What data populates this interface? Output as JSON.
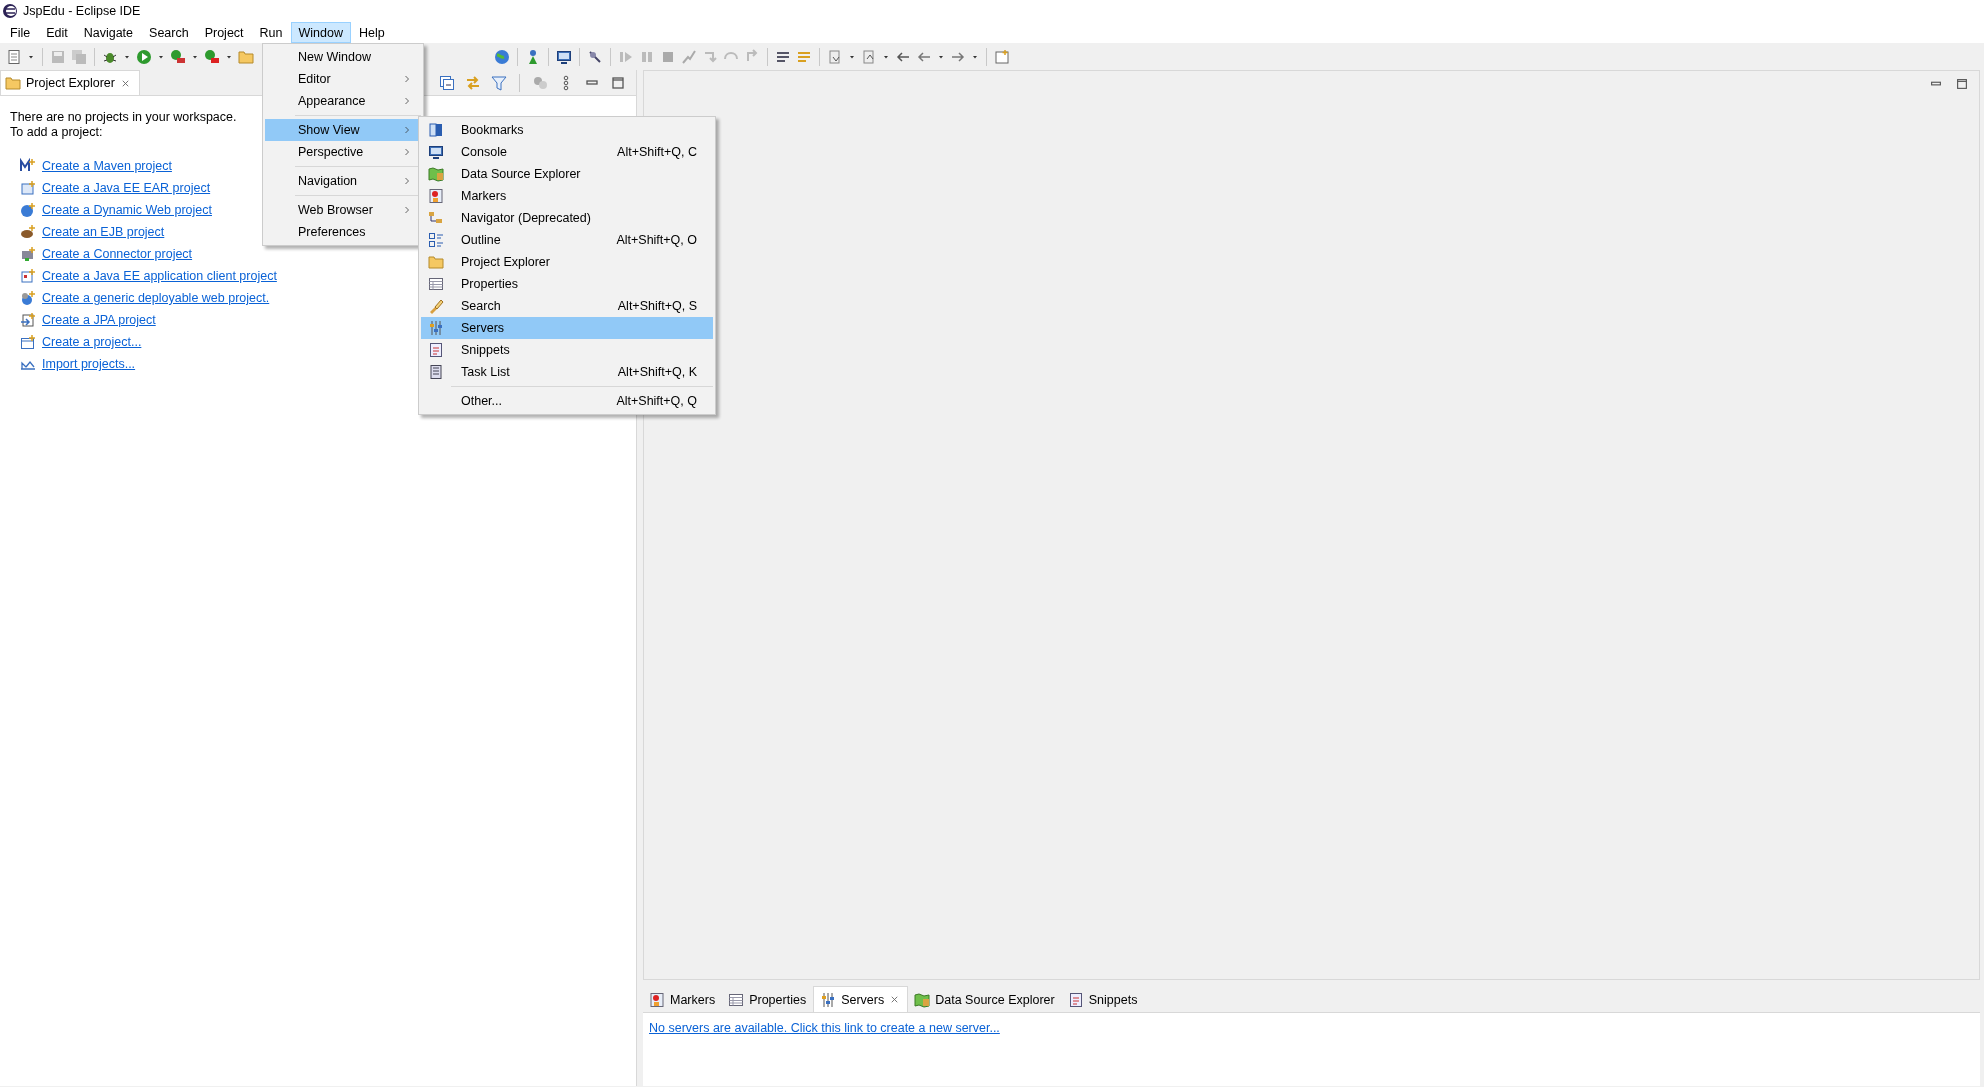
{
  "window": {
    "title": "JspEdu - Eclipse IDE"
  },
  "menu_bar": [
    {
      "label": "File",
      "selected": false
    },
    {
      "label": "Edit",
      "selected": false
    },
    {
      "label": "Navigate",
      "selected": false
    },
    {
      "label": "Search",
      "selected": false
    },
    {
      "label": "Project",
      "selected": false
    },
    {
      "label": "Run",
      "selected": false
    },
    {
      "label": "Window",
      "selected": true
    },
    {
      "label": "Help",
      "selected": false
    }
  ],
  "project_explorer": {
    "tab": {
      "label": "Project Explorer",
      "selected": true
    },
    "message": [
      "There are no projects in your workspace.",
      "To add a project:"
    ],
    "links": [
      "Create a Maven project",
      "Create a Java EE EAR project",
      "Create a Dynamic Web project",
      "Create an EJB project",
      "Create a Connector project",
      "Create a Java EE application client project",
      "Create a generic deployable web project.",
      "Create a JPA project",
      "Create a project...",
      "Import projects..."
    ]
  },
  "window_menu": [
    {
      "label": "New Window",
      "submenu": false,
      "selected": false,
      "separator_before": false
    },
    {
      "label": "Editor",
      "submenu": true,
      "selected": false,
      "separator_before": false
    },
    {
      "label": "Appearance",
      "submenu": true,
      "selected": false,
      "separator_before": false
    },
    {
      "label": "Show View",
      "submenu": true,
      "selected": true,
      "separator_before": true
    },
    {
      "label": "Perspective",
      "submenu": true,
      "selected": false,
      "separator_before": false
    },
    {
      "label": "Navigation",
      "submenu": true,
      "selected": false,
      "separator_before": true
    },
    {
      "label": "Web Browser",
      "submenu": true,
      "selected": false,
      "separator_before": true
    },
    {
      "label": "Preferences",
      "submenu": false,
      "selected": false,
      "separator_before": false
    }
  ],
  "show_view_menu": [
    {
      "label": "Bookmarks",
      "selected": false,
      "separator_before": false
    },
    {
      "label": "Console",
      "shortcut": "Alt+Shift+Q, C",
      "selected": false,
      "separator_before": false
    },
    {
      "label": "Data Source Explorer",
      "selected": false,
      "separator_before": false
    },
    {
      "label": "Markers",
      "selected": false,
      "separator_before": false
    },
    {
      "label": "Navigator (Deprecated)",
      "selected": false,
      "separator_before": false
    },
    {
      "label": "Outline",
      "shortcut": "Alt+Shift+Q, O",
      "selected": false,
      "separator_before": false
    },
    {
      "label": "Project Explorer",
      "selected": false,
      "separator_before": false
    },
    {
      "label": "Properties",
      "selected": false,
      "separator_before": false
    },
    {
      "label": "Search",
      "shortcut": "Alt+Shift+Q, S",
      "selected": false,
      "separator_before": false
    },
    {
      "label": "Servers",
      "selected": true,
      "separator_before": false
    },
    {
      "label": "Snippets",
      "selected": false,
      "separator_before": false
    },
    {
      "label": "Task List",
      "shortcut": "Alt+Shift+Q, K",
      "selected": false,
      "separator_before": false
    },
    {
      "label": "Other...",
      "shortcut": "Alt+Shift+Q, Q",
      "selected": false,
      "separator_before": true
    }
  ],
  "bottom_panel": {
    "tabs": [
      {
        "label": "Markers",
        "selected": false
      },
      {
        "label": "Properties",
        "selected": false
      },
      {
        "label": "Servers",
        "selected": true
      },
      {
        "label": "Data Source Explorer",
        "selected": false
      },
      {
        "label": "Snippets",
        "selected": false
      }
    ],
    "link": "No servers are available. Click this link to create a new server..."
  }
}
